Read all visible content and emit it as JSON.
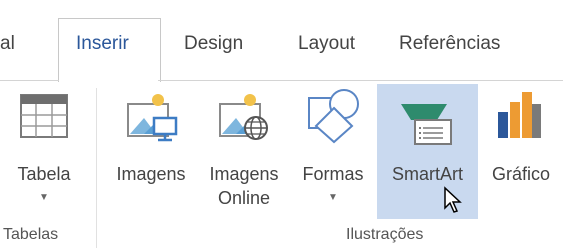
{
  "tabs": [
    {
      "label": "al"
    },
    {
      "label": "Inserir",
      "active": true
    },
    {
      "label": "Design"
    },
    {
      "label": "Layout"
    },
    {
      "label": "Referências"
    }
  ],
  "groups": {
    "tabelas": {
      "label": "Tabelas"
    },
    "ilustracoes": {
      "label": "Ilustrações"
    }
  },
  "commands": {
    "tabela": {
      "label": "Tabela",
      "icon": "table-icon"
    },
    "imagens": {
      "label": "Imagens",
      "icon": "pictures-icon"
    },
    "imagens_online": {
      "label_line1": "Imagens",
      "label_line2": "Online",
      "icon": "online-pictures-icon"
    },
    "formas": {
      "label": "Formas",
      "icon": "shapes-icon"
    },
    "smartart": {
      "label": "SmartArt",
      "icon": "smartart-icon",
      "highlighted": true
    },
    "grafico": {
      "label": "Gráfico",
      "icon": "chart-icon"
    }
  },
  "colors": {
    "accent": "#2b579a",
    "hover": "#c9d9ef"
  }
}
